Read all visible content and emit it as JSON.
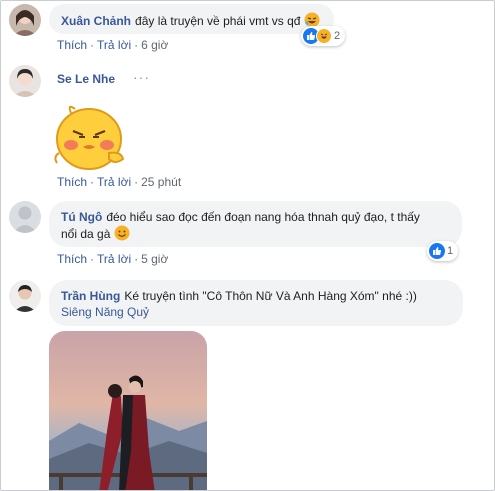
{
  "comments": [
    {
      "author": "Xuân Chảnh",
      "text": "đây là truyện về phái vmt vs qđ",
      "like_label": "Thích",
      "reply_label": "Trả lời",
      "time": "6 giờ",
      "reaction_count": "2"
    },
    {
      "author": "Se Le Nhe",
      "sticker": "blushing-chick-sticker",
      "like_label": "Thích",
      "reply_label": "Trả lời",
      "time": "25 phút"
    },
    {
      "author": "Tú Ngô",
      "text_line1": "đéo hiểu sao đọc đến đoạn nang hóa thnah quỷ đạo, t thấy",
      "text_line2": "nổi da gà",
      "like_label": "Thích",
      "reply_label": "Trả lời",
      "time": "5 giờ",
      "reaction_count": "1"
    },
    {
      "author": "Trần Hùng",
      "text": "Ké truyện tình \"Cô Thôn Nữ Và Anh Hàng Xóm\" nhé :))",
      "mention": "Siêng Năng Quỷ",
      "image": "couple-photo"
    }
  ],
  "colors": {
    "link": "#385898",
    "bubble": "#f2f3f5",
    "meta": "#606770",
    "like_blue": "#1877f2"
  }
}
